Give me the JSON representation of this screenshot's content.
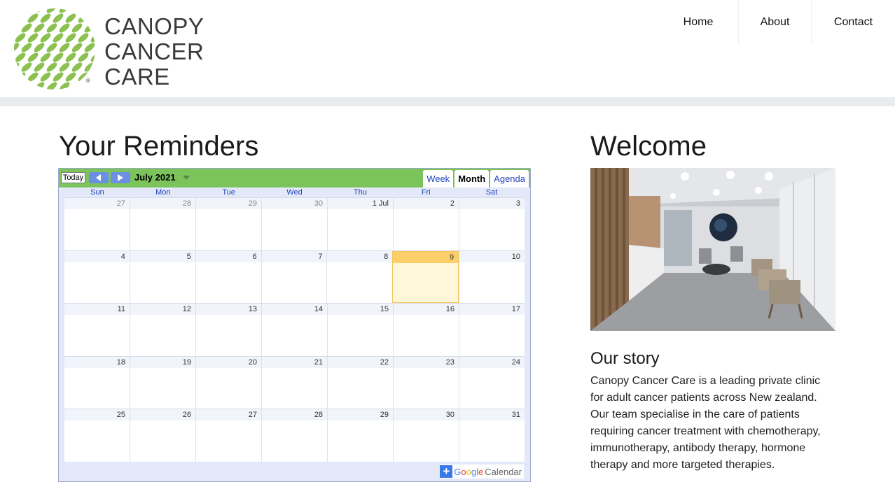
{
  "brand": {
    "logo_lines": [
      "CANOPY",
      "CANCER",
      "CARE"
    ],
    "registered_mark": "®",
    "green": "#8cc152"
  },
  "nav": {
    "items": [
      {
        "label": "Home"
      },
      {
        "label": "About"
      },
      {
        "label": "Contact"
      }
    ]
  },
  "reminders": {
    "title": "Your Reminders"
  },
  "calendar": {
    "today_label": "Today",
    "month_label": "July 2021",
    "tabs": [
      "Week",
      "Month",
      "Agenda"
    ],
    "active_tab": "Month",
    "weekdays": [
      "Sun",
      "Mon",
      "Tue",
      "Wed",
      "Thu",
      "Fri",
      "Sat"
    ],
    "weeks": [
      [
        "27",
        "28",
        "29",
        "30",
        "1 Jul",
        "2",
        "3"
      ],
      [
        "4",
        "5",
        "6",
        "7",
        "8",
        "9",
        "10"
      ],
      [
        "11",
        "12",
        "13",
        "14",
        "15",
        "16",
        "17"
      ],
      [
        "18",
        "19",
        "20",
        "21",
        "22",
        "23",
        "24"
      ],
      [
        "25",
        "26",
        "27",
        "28",
        "29",
        "30",
        "31"
      ]
    ],
    "today": "9",
    "badge_google": "Google",
    "badge_calendar": "Calendar",
    "toolbar_color": "#7cc35c",
    "today_color": "#fccf69"
  },
  "welcome": {
    "title": "Welcome",
    "photo_alt": "clinic waiting room",
    "story_title": "Our story",
    "story_text": "Canopy Cancer Care is a leading private clinic for adult cancer patients across New zealand. Our team specialise in the care of patients requiring cancer treatment with chemotherapy, immunotherapy, antibody therapy, hormone therapy and more targeted therapies."
  }
}
